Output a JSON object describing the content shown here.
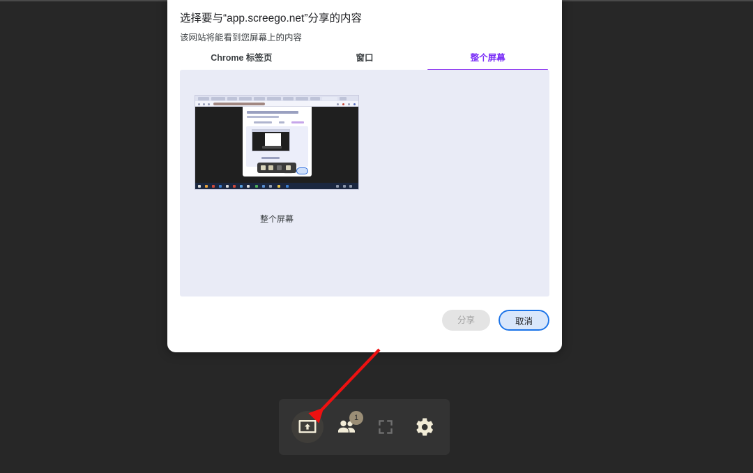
{
  "page": {
    "background_color": "#272727"
  },
  "dialog": {
    "title": "选择要与“app.screego.net”分享的内容",
    "subtitle": "该网站将能看到您屏幕上的内容",
    "accent_color": "#8b33f0",
    "tabs": [
      {
        "label": "Chrome 标签页",
        "active": false
      },
      {
        "label": "窗口",
        "active": false
      },
      {
        "label": "整个屏幕",
        "active": true
      }
    ],
    "preview": {
      "caption": "整个屏幕",
      "panel_color": "#e9ebf6"
    },
    "actions": {
      "share_label": "分享",
      "share_disabled": true,
      "cancel_label": "取消",
      "cancel_focus_color": "#1a73e8"
    }
  },
  "toolbar": {
    "background_color": "#333333",
    "icon_color": "#f2ecd7",
    "badge_color": "#9b8e76",
    "buttons": [
      {
        "name": "share-screen",
        "icon": "screen-share-icon",
        "active": true,
        "badge": null
      },
      {
        "name": "participants",
        "icon": "people-icon",
        "active": false,
        "badge": "1"
      },
      {
        "name": "fullscreen",
        "icon": "fullscreen-icon",
        "active": false,
        "badge": null
      },
      {
        "name": "settings",
        "icon": "gear-icon",
        "active": false,
        "badge": null
      }
    ]
  },
  "annotation": {
    "arrow_color": "#ee1111",
    "points_to": "share-screen-button"
  }
}
